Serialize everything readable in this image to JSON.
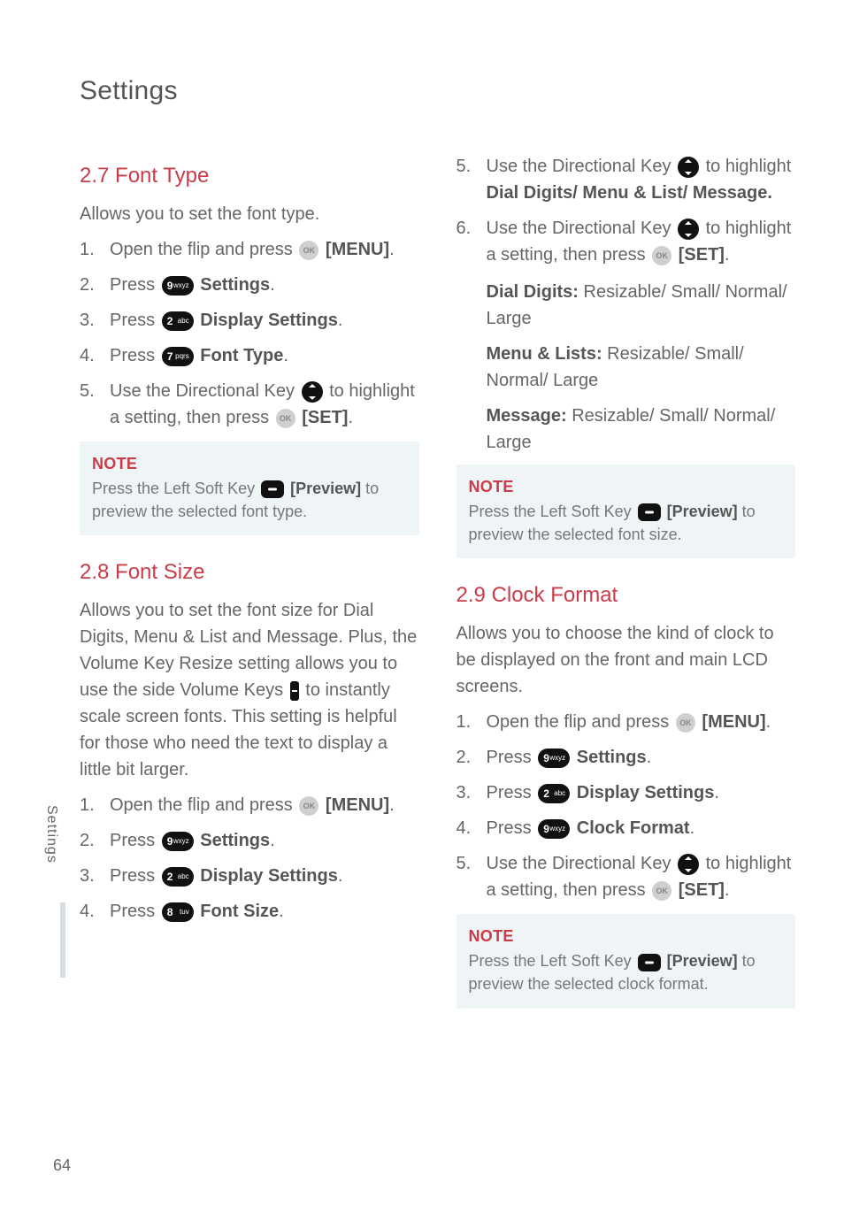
{
  "page_title": "Settings",
  "side_tab": "Settings",
  "page_number": "64",
  "left": {
    "s27": {
      "heading": "2.7 Font Type",
      "intro": "Allows you to set the font type.",
      "steps": {
        "s1a": "Open the flip and press ",
        "s1b": "[MENU]",
        "s1c": ".",
        "s2a": "Press ",
        "s2b": "Settings",
        "s2c": ".",
        "s3a": "Press ",
        "s3b": "Display Settings",
        "s3c": ".",
        "s4a": "Press ",
        "s4b": "Font Type",
        "s4c": ".",
        "s5a": "Use the Directional Key ",
        "s5b": " to highlight a setting, then press ",
        "s5c": "[SET]",
        "s5d": "."
      },
      "note_title": "NOTE",
      "note_a": "Press the Left Soft Key ",
      "note_b": "[Preview]",
      "note_c": " to preview the selected font type."
    },
    "s28": {
      "heading": "2.8 Font Size",
      "intro_a": "Allows you to set the font size for Dial Digits, Menu & List and Message. Plus, the Volume Key Resize setting allows you to use the side Volume Keys ",
      "intro_b": " to instantly scale screen fonts. This setting is helpful for those who need the text to display a little bit larger.",
      "steps": {
        "s1a": "Open the flip and press ",
        "s1b": "[MENU]",
        "s1c": ".",
        "s2a": "Press ",
        "s2b": "Settings",
        "s2c": ".",
        "s3a": "Press ",
        "s3b": "Display Settings",
        "s3c": ".",
        "s4a": "Press ",
        "s4b": "Font Size",
        "s4c": "."
      }
    }
  },
  "right": {
    "s28cont": {
      "steps": {
        "s5a": "Use the Directional Key ",
        "s5b": " to highlight ",
        "s5c": "Dial Digits/ Menu & List/ Message.",
        "s6a": "Use the Directional Key ",
        "s6b": " to highlight a setting, then press ",
        "s6c": "[SET]",
        "s6d": "."
      },
      "dd_label": "Dial Digits:",
      "dd_val": " Resizable/ Small/ Normal/ Large",
      "ml_label": "Menu & Lists:",
      "ml_val": " Resizable/ Small/ Normal/ Large",
      "msg_label": "Message:",
      "msg_val": " Resizable/ Small/ Normal/ Large",
      "note_title": "NOTE",
      "note_a": "Press the Left Soft Key ",
      "note_b": "[Preview]",
      "note_c": " to preview the selected font size."
    },
    "s29": {
      "heading": "2.9 Clock Format",
      "intro": "Allows you to choose the kind of clock to be displayed on the front and main LCD screens.",
      "steps": {
        "s1a": "Open the flip and press ",
        "s1b": "[MENU]",
        "s1c": ".",
        "s2a": "Press ",
        "s2b": "Settings",
        "s2c": ".",
        "s3a": "Press ",
        "s3b": "Display Settings",
        "s3c": ".",
        "s4a": "Press ",
        "s4b": "Clock Format",
        "s4c": ".",
        "s5a": "Use the Directional Key ",
        "s5b": " to highlight a setting, then press ",
        "s5c": "[SET]",
        "s5d": "."
      },
      "note_title": "NOTE",
      "note_a": "Press the Left Soft Key ",
      "note_b": "[Preview]",
      "note_c": " to preview the selected clock format."
    }
  },
  "keys": {
    "k2n": "2",
    "k2l": "abc",
    "k7n": "7",
    "k7l": "pqrs",
    "k8n": "8",
    "k8l": "tuv",
    "k9n": "9",
    "k9l": "wxyz",
    "ok": "OK"
  }
}
